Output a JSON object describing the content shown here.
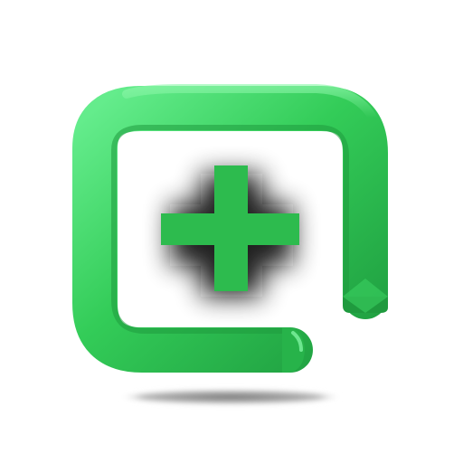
{
  "app_icon": {
    "name": "green-plus-frame-icon",
    "colors": {
      "frame_light": "#5ee887",
      "frame_mid": "#2fc753",
      "frame_dark": "#1e9f3f",
      "plus_fill": "#2dbb4e",
      "plus_glow": "#111111",
      "shadow": "#8c8c8c",
      "background": "#ffffff"
    }
  }
}
